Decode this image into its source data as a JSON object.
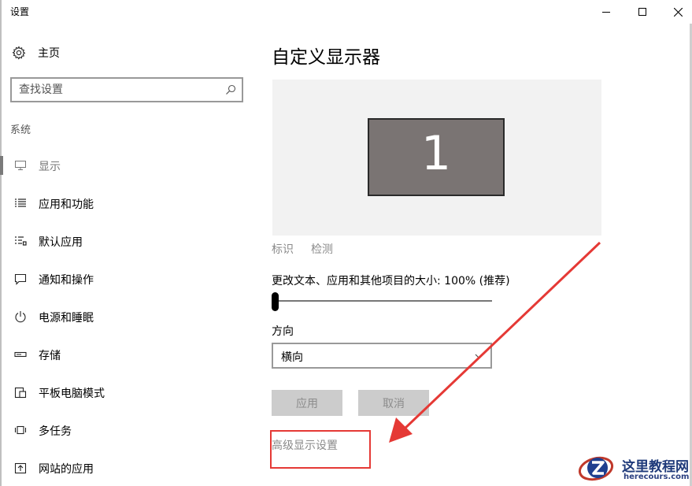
{
  "window": {
    "title": "设置",
    "controls": {
      "minimize": "minimize-icon",
      "maximize": "maximize-icon",
      "close": "close-icon"
    }
  },
  "sidebar": {
    "home_label": "主页",
    "search_placeholder": "查找设置",
    "section_label": "系统",
    "items": [
      {
        "label": "显示",
        "icon": "display-icon",
        "active": true
      },
      {
        "label": "应用和功能",
        "icon": "apps-features-icon"
      },
      {
        "label": "默认应用",
        "icon": "default-apps-icon"
      },
      {
        "label": "通知和操作",
        "icon": "notifications-icon"
      },
      {
        "label": "电源和睡眠",
        "icon": "power-icon"
      },
      {
        "label": "存储",
        "icon": "storage-icon"
      },
      {
        "label": "平板电脑模式",
        "icon": "tablet-mode-icon"
      },
      {
        "label": "多任务",
        "icon": "multitasking-icon"
      },
      {
        "label": "网站的应用",
        "icon": "apps-for-websites-icon"
      }
    ]
  },
  "main": {
    "title": "自定义显示器",
    "monitor_number": "1",
    "identify_link": "标识",
    "detect_link": "检测",
    "scale_label": "更改文本、应用和其他项目的大小: 100% (推荐)",
    "scale_value_fraction": 0.0,
    "orientation_label": "方向",
    "orientation_value": "横向",
    "apply_label": "应用",
    "cancel_label": "取消",
    "advanced_link": "高级显示设置"
  },
  "annotation": {
    "color": "#e53935"
  },
  "watermark": {
    "text": "这里教程网",
    "url": "herecours.com"
  },
  "colors": {
    "accent_gray": "#7a7a7a",
    "monitor_fill": "#7a7473",
    "button_bg": "#cccccc"
  }
}
